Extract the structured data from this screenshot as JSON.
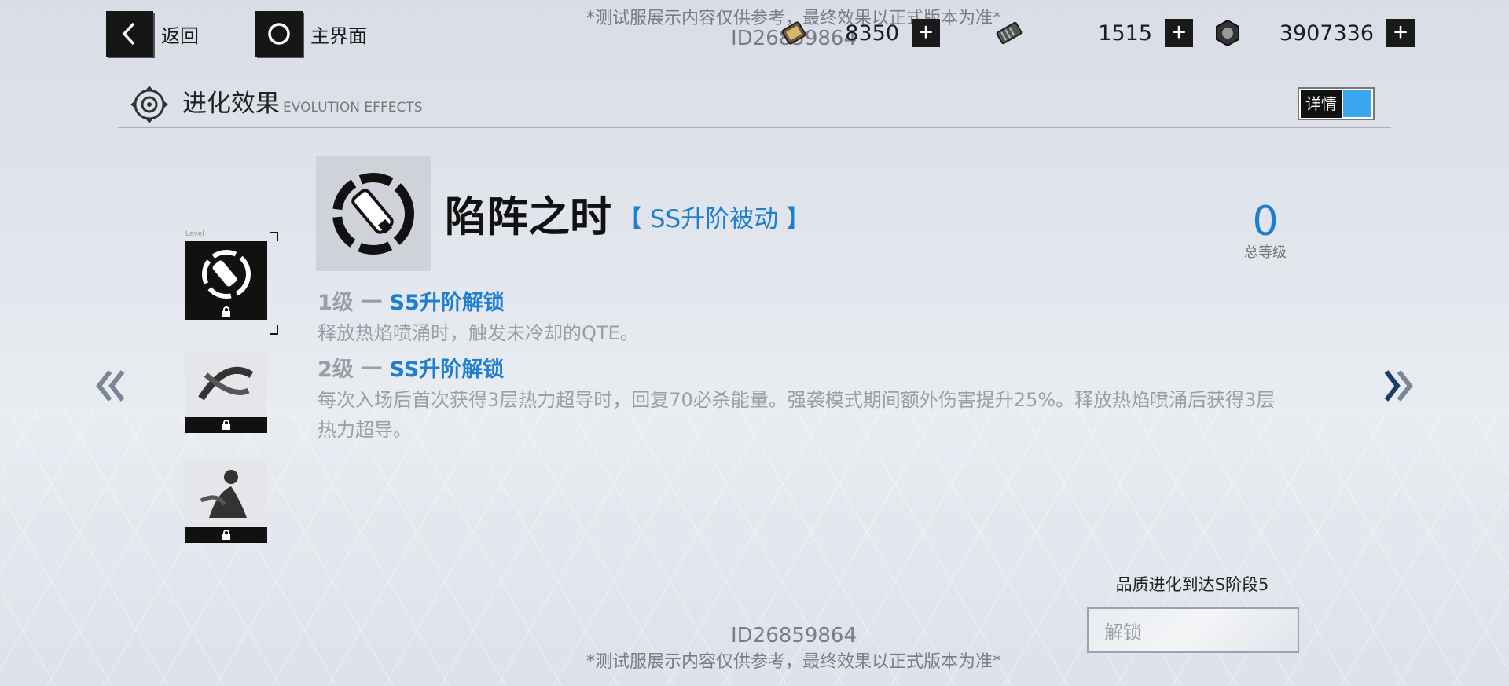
{
  "header": {
    "back_label": "返回",
    "home_label": "主界面",
    "watermark_top": "*测试服展示内容仅供参考，最终效果以正式版本为准*",
    "watermark_id_top": "ID26859864"
  },
  "resources": [
    {
      "icon": "ticket-icon",
      "value": "8350"
    },
    {
      "icon": "battery-cell-icon",
      "value": "1515"
    },
    {
      "icon": "hex-nut-icon",
      "value": "3907336"
    }
  ],
  "section": {
    "title_zh": "进化效果",
    "title_en": "EVOLUTION EFFECTS",
    "detail_label": "详情",
    "toggle_color": "#3aa6ee"
  },
  "skill": {
    "name": "陷阵之时",
    "tag": "【 SS升阶被动 】",
    "total_level": "0",
    "total_level_label": "总等级",
    "levels": [
      {
        "prefix": "1级 一 ",
        "unlock": "S5升阶解锁",
        "desc": "释放热焰喷涌时，触发未冷却的QTE。"
      },
      {
        "prefix": "2级 一 ",
        "unlock": "SS升阶解锁",
        "desc": "每次入场后首次获得3层热力超导时，回复70必杀能量。强袭模式期间额外伤害提升25%。释放热焰喷涌后获得3层热力超导。"
      }
    ]
  },
  "sidebar": {
    "level_tiny": "Level",
    "thumbs": [
      {
        "name": "thumb-flamethrower",
        "selected": true
      },
      {
        "name": "thumb-slash",
        "selected": false
      },
      {
        "name": "thumb-figure",
        "selected": false
      }
    ]
  },
  "unlock": {
    "requirement": "品质进化到达S阶段5",
    "button_label": "解锁"
  },
  "footer": {
    "id": "ID26859864",
    "watermark": "*测试服展示内容仅供参考，最终效果以正式版本为准*"
  },
  "colors": {
    "accent": "#1d7fd0",
    "muted": "#9a9ea6"
  }
}
